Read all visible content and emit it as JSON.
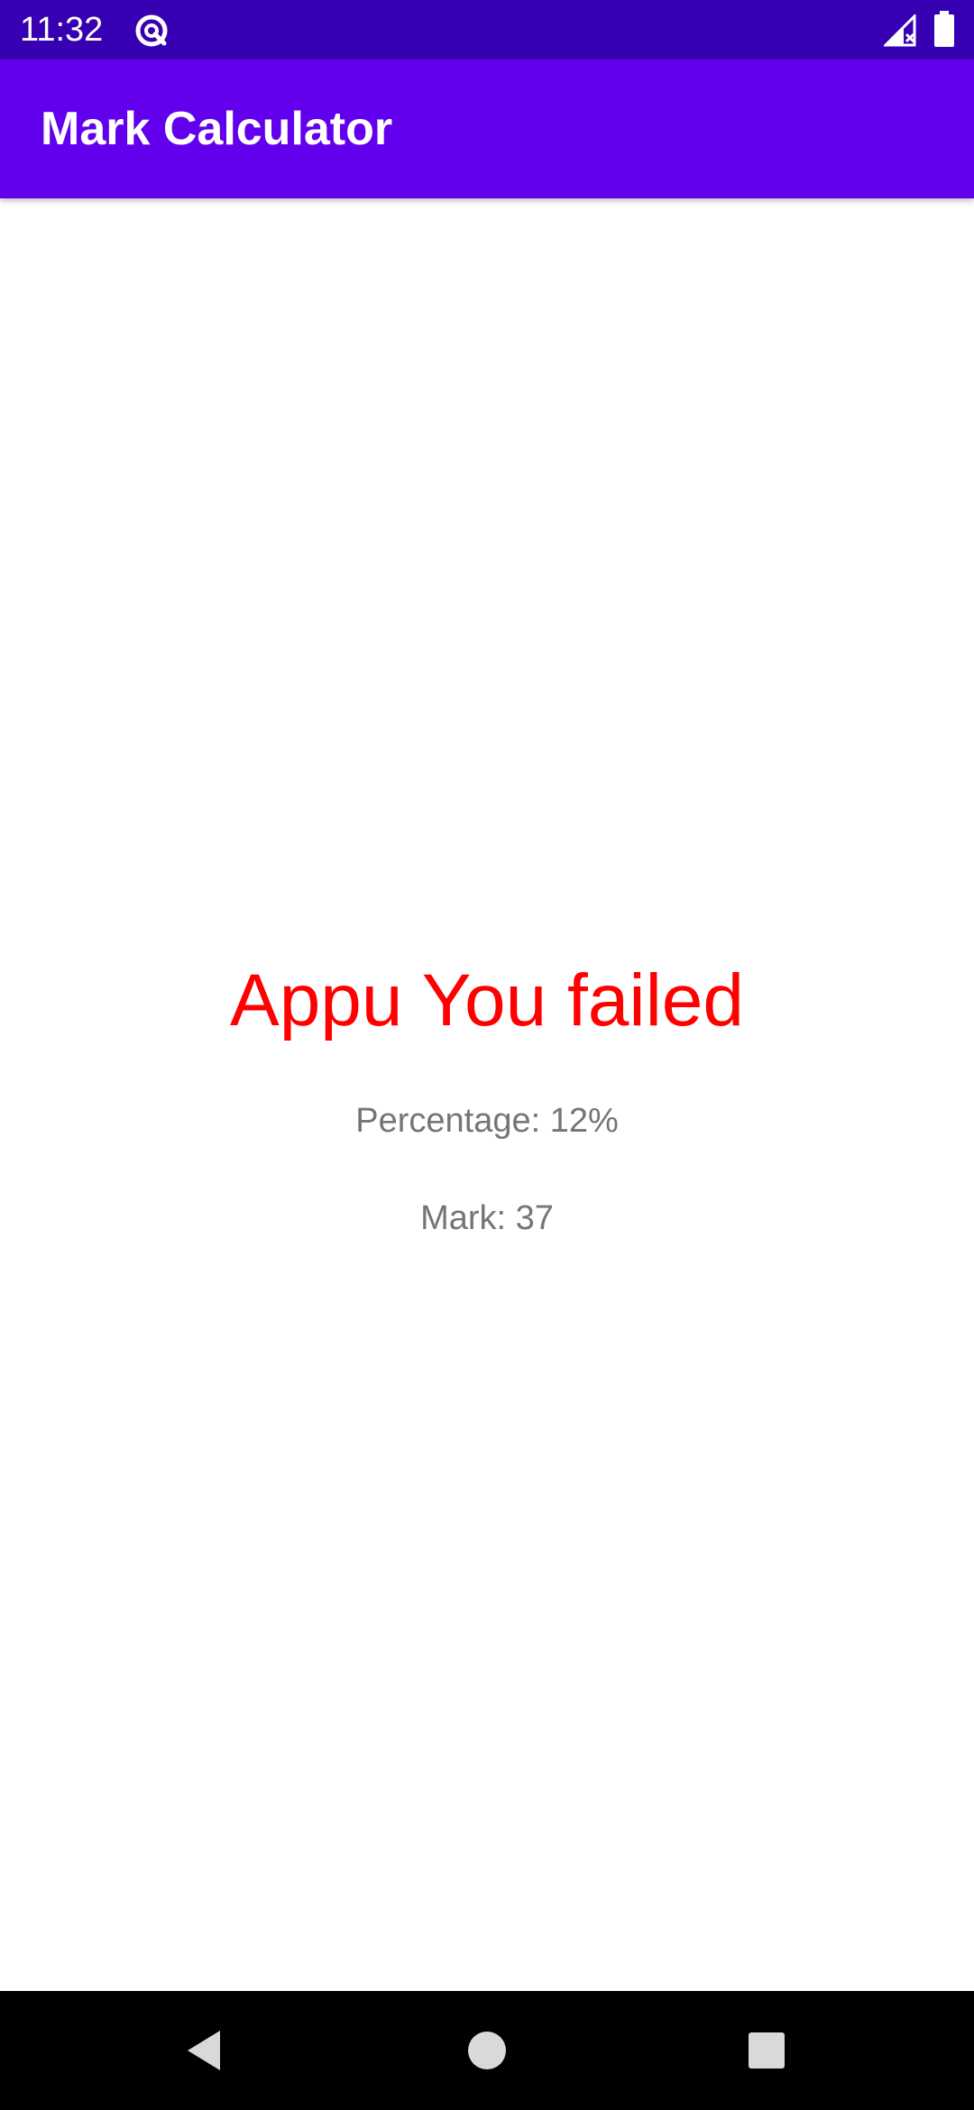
{
  "status_bar": {
    "time": "11:32",
    "background": "#3700b3",
    "icons": [
      "app-notification-icon",
      "signal-icon",
      "battery-icon"
    ]
  },
  "app_bar": {
    "title": "Mark Calculator",
    "background": "#6200ee"
  },
  "result": {
    "title": "Appu You failed",
    "title_color": "#ff0000",
    "percentage": "Percentage: 12%",
    "mark": "Mark: 37"
  },
  "nav_bar": {
    "buttons": [
      "back-icon",
      "home-icon",
      "recents-icon"
    ]
  }
}
